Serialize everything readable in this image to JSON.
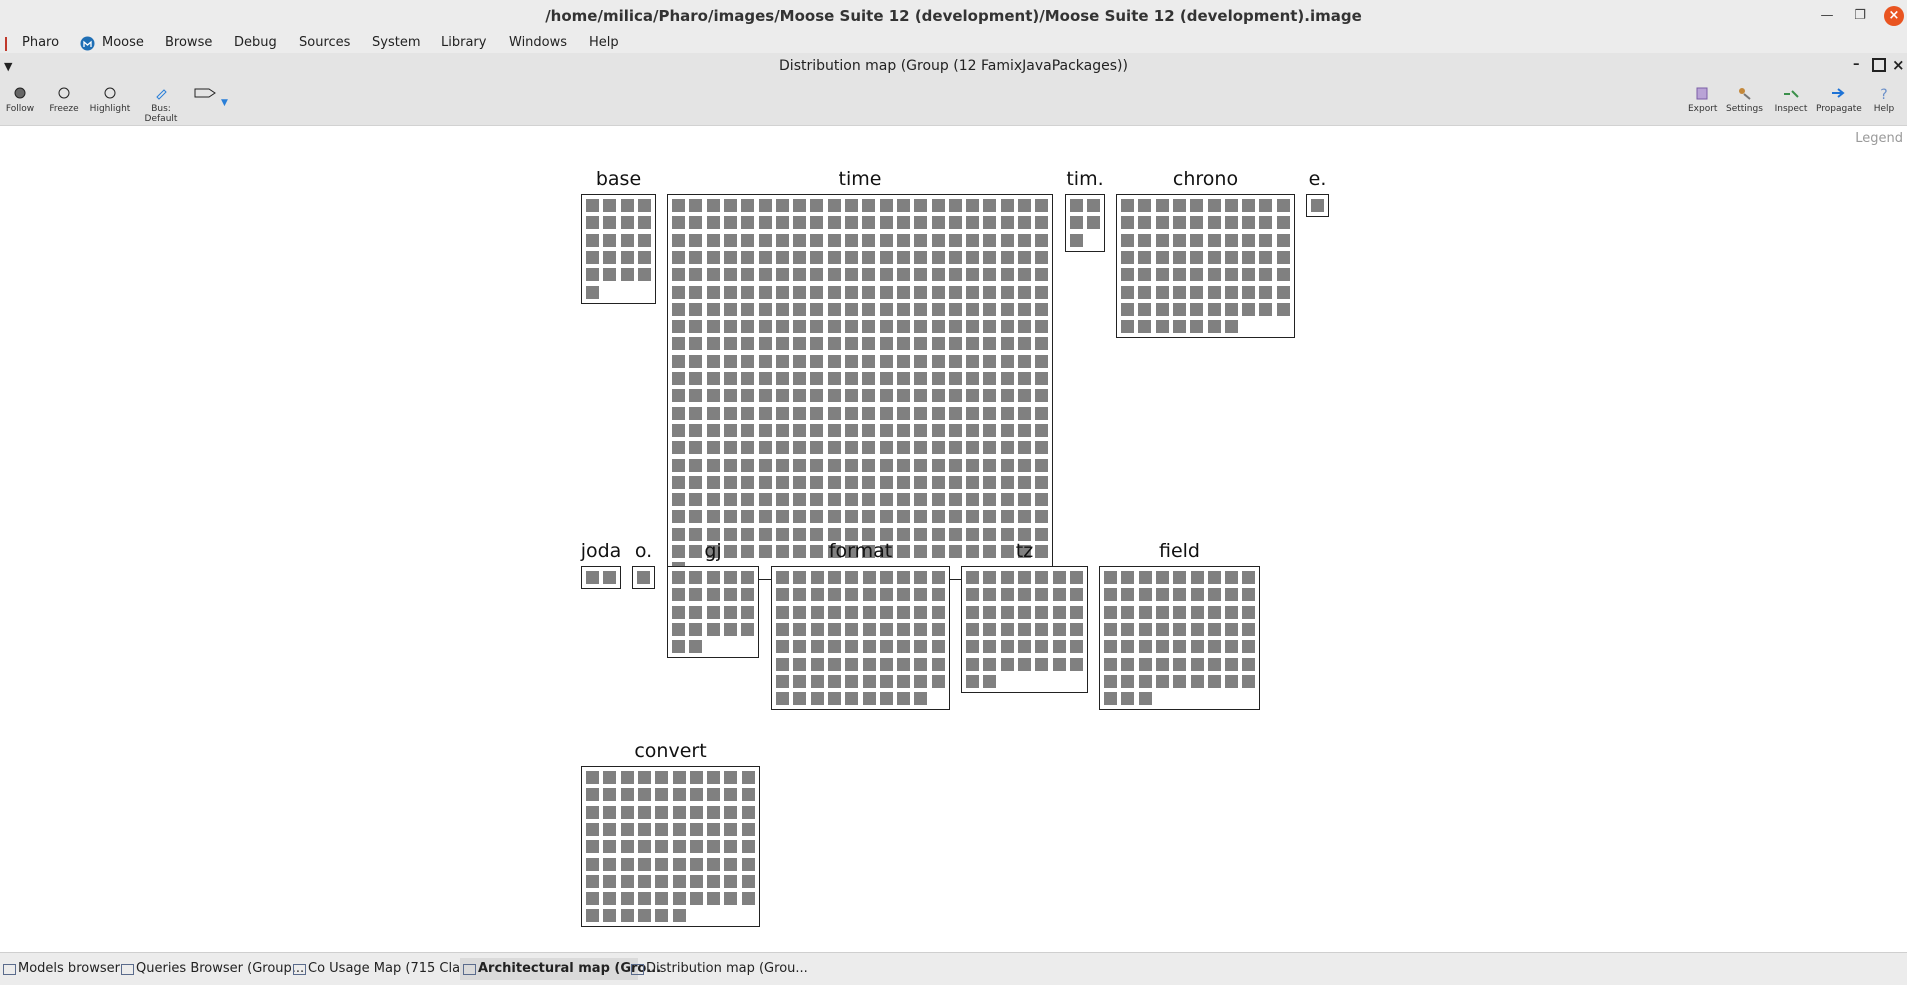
{
  "os": {
    "title": "/home/milica/Pharo/images/Moose Suite 12 (development)/Moose Suite 12 (development).image"
  },
  "menu": [
    "Pharo",
    "Moose",
    "Browse",
    "Debug",
    "Sources",
    "System",
    "Library",
    "Windows",
    "Help"
  ],
  "window": {
    "title": "Distribution map (Group (12 FamixJavaPackages))"
  },
  "toolbar": {
    "left": [
      {
        "label": "Follow",
        "icon": "filled-circle-icon"
      },
      {
        "label": "Freeze",
        "icon": "circle-icon"
      },
      {
        "label": "Highlight",
        "icon": "circle-icon"
      },
      {
        "label": "Bus: Default",
        "icon": "pencil-icon"
      },
      {
        "label": "",
        "icon": "tag-icon"
      }
    ],
    "right": [
      {
        "label": "Export",
        "icon": "export-icon"
      },
      {
        "label": "Settings",
        "icon": "settings-icon"
      },
      {
        "label": "Inspect",
        "icon": "inspect-icon"
      },
      {
        "label": "Propagate",
        "icon": "propagate-icon"
      },
      {
        "label": "Help",
        "icon": "help-icon"
      }
    ]
  },
  "legend_label": "Legend",
  "packages": [
    {
      "name": "base",
      "classes": 21
    },
    {
      "name": "time",
      "classes": 463
    },
    {
      "name": "tim.",
      "classes": 5
    },
    {
      "name": "chrono",
      "classes": 77
    },
    {
      "name": "e.",
      "classes": 1
    },
    {
      "name": "joda",
      "classes": 2
    },
    {
      "name": "o.",
      "classes": 1
    },
    {
      "name": "gj",
      "classes": 22
    },
    {
      "name": "format",
      "classes": 79
    },
    {
      "name": "tz",
      "classes": 44
    },
    {
      "name": "field",
      "classes": 66
    },
    {
      "name": "convert",
      "classes": 86
    }
  ],
  "taskbar": [
    {
      "label": "Models browser",
      "active": false
    },
    {
      "label": "Queries Browser (Group...",
      "active": false
    },
    {
      "label": "Co Usage Map (715 Clas...",
      "active": false
    },
    {
      "label": "Architectural map (Gro...",
      "active": true
    },
    {
      "label": "Distribution map (Grou...",
      "active": false
    }
  ],
  "colors": {
    "cell": "#808080",
    "close": "#e95420"
  }
}
